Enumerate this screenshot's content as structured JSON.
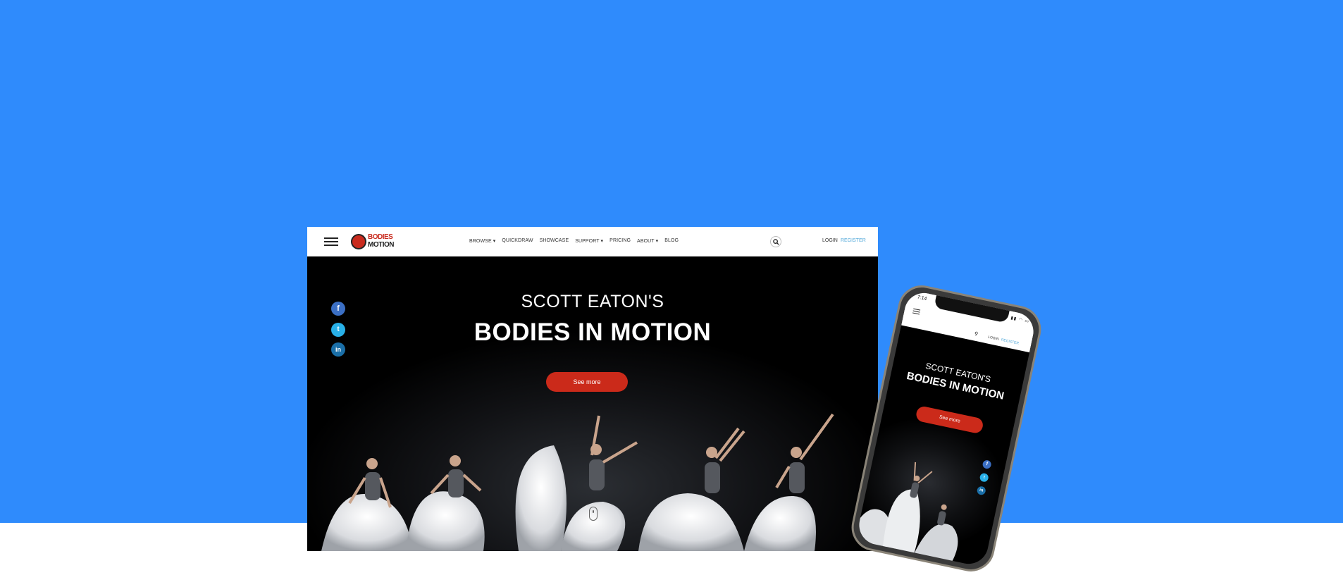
{
  "desktop": {
    "nav": {
      "logo_top": "BODIES",
      "logo_bottom": "MOTION",
      "menu": [
        "BROWSE ▾",
        "QUICKDRAW",
        "SHOWCASE",
        "SUPPORT ▾",
        "PRICING",
        "ABOUT ▾",
        "BLOG"
      ],
      "login": "LOGIN",
      "register": "REGISTER"
    },
    "hero": {
      "pretitle": "SCOTT EATON'S",
      "title": "BODIES IN MOTION",
      "button": "See more"
    },
    "social": {
      "facebook": "f",
      "twitter": "t",
      "linkedin": "in"
    }
  },
  "phone": {
    "status": {
      "time": "7:14"
    },
    "nav": {
      "login": "LOGIN",
      "register": "REGISTER"
    },
    "hero": {
      "pretitle": "SCOTT EATON'S",
      "title": "BODIES IN MOTION",
      "button": "See more"
    },
    "social": {
      "facebook": "f",
      "twitter": "t",
      "linkedin": "in"
    }
  },
  "colors": {
    "background_blue": "#2f8bfc",
    "accent_red": "#cb2a1a",
    "register_blue": "#4fa7d9",
    "facebook": "#3b6fc4",
    "twitter": "#28b0e8",
    "linkedin": "#1a6fa8"
  },
  "icons": [
    "hamburger-menu-icon",
    "search-icon",
    "facebook-icon",
    "twitter-icon",
    "linkedin-icon",
    "scroll-mouse-icon"
  ]
}
